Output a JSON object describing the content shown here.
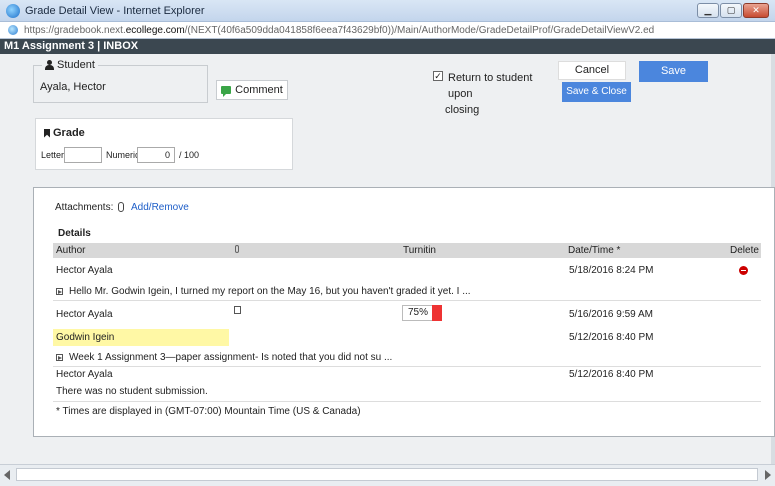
{
  "window": {
    "title": "Grade Detail View - Internet Explorer",
    "url_prefix": "https://gradebook.next.",
    "url_domain": "ecollege.com",
    "url_rest": "/(NEXT(40f6a509dda041858f6eea7f43629bf0))/Main/AuthorMode/GradeDetailProf/GradeDetailViewV2.ed",
    "minimize": "▁",
    "maximize": "▢",
    "close": "✕"
  },
  "page": {
    "heading": "M1 Assignment 3 | INBOX",
    "student_label": "Student",
    "student_name": "Ayala, Hector",
    "comment_label": "Comment",
    "return_text_1": "Return to student upon",
    "return_text_2": "closing",
    "return_checked": "✓",
    "cancel_label": "Cancel",
    "save_label": "Save",
    "save_close_label": "Save & Close"
  },
  "grade": {
    "title": "Grade",
    "letter_label": "Letter",
    "letter_value": "",
    "numeric_label": "Numeric",
    "numeric_value": "0",
    "out_of": "/ 100"
  },
  "details": {
    "attachments_label": "Attachments:",
    "add_remove_label": "Add/Remove",
    "title": "Details",
    "columns": {
      "author": "Author",
      "turnitin": "Turnitin",
      "datetime": "Date/Time *",
      "delete": "Delete"
    },
    "rows": [
      {
        "author": "Hector Ayala",
        "datetime": "5/18/2016 8:24 PM",
        "message": "Hello Mr. Godwin Igein, I turned my report on the May 16, but you haven't graded it yet. I ..."
      },
      {
        "author": "Hector Ayala",
        "datetime": "5/16/2016 9:59 AM",
        "turnitin": "75%"
      },
      {
        "author": "Godwin Igein",
        "datetime": "5/12/2016 8:40 PM",
        "message": "Week 1 Assignment 3—paper assignment- Is noted that you did not su ..."
      },
      {
        "author": "Hector Ayala",
        "datetime": "5/12/2016 8:40 PM",
        "message": "There was no student submission."
      }
    ],
    "footnote": "* Times are displayed in (GMT-07:00) Mountain Time (US & Canada)"
  },
  "colors": {
    "accent": "#4b86dd",
    "header_bar": "#3b4750",
    "highlight": "#fff8a5",
    "turnitin_alert": "#e33333",
    "link": "#1e5ec8"
  }
}
